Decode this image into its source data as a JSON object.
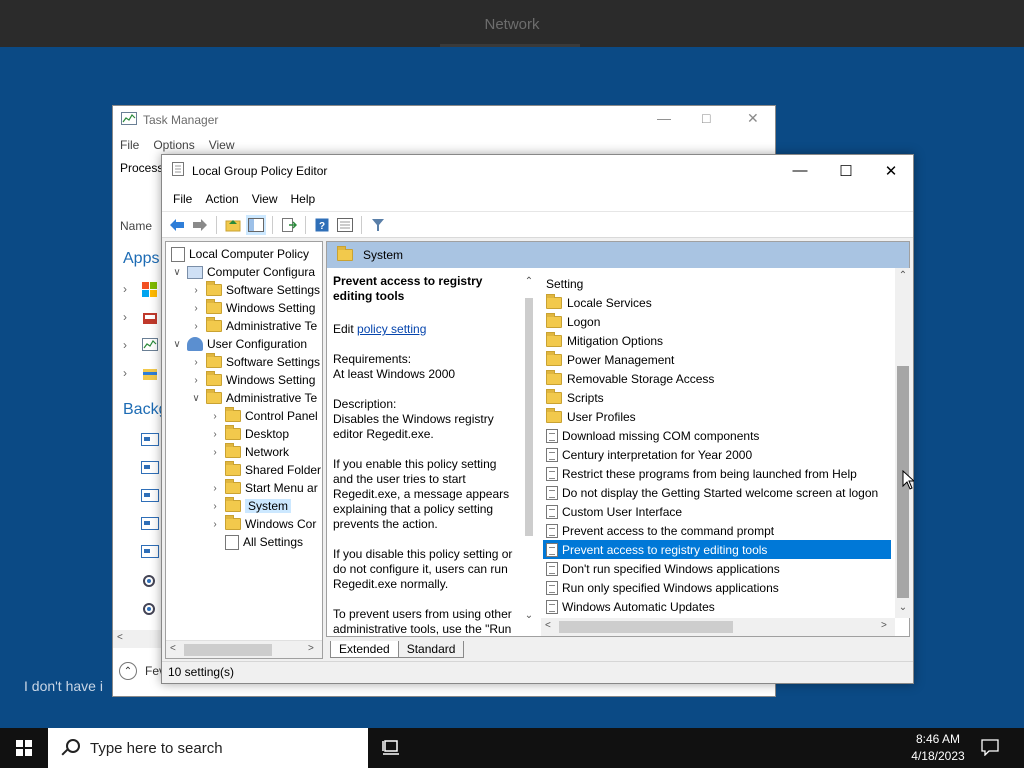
{
  "background": {
    "top_title": "Network",
    "bottom_text": "I don't have i"
  },
  "task_manager": {
    "title": "Task Manager",
    "menu": [
      "File",
      "Options",
      "View"
    ],
    "tab_partial": "Process",
    "col_name": "Name",
    "apps_heading": "Apps",
    "bg_heading": "Backg",
    "fewer_details": "Fev"
  },
  "gpe": {
    "title": "Local Group Policy Editor",
    "menu": [
      "File",
      "Action",
      "View",
      "Help"
    ],
    "tree": [
      {
        "label": "Local Computer Policy",
        "level": 0,
        "icon": "doc-icon",
        "arrow": ""
      },
      {
        "label": "Computer Configura",
        "level": 1,
        "icon": "computer-icon",
        "arrow": "v"
      },
      {
        "label": "Software Settings",
        "level": 2,
        "icon": "folder-icon",
        "arrow": ">"
      },
      {
        "label": "Windows Setting",
        "level": 2,
        "icon": "folder-icon",
        "arrow": ">"
      },
      {
        "label": "Administrative Te",
        "level": 2,
        "icon": "folder-icon",
        "arrow": ">"
      },
      {
        "label": "User Configuration",
        "level": 1,
        "icon": "user-icon",
        "arrow": "v"
      },
      {
        "label": "Software Settings",
        "level": 2,
        "icon": "folder-icon",
        "arrow": ">"
      },
      {
        "label": "Windows Setting",
        "level": 2,
        "icon": "folder-icon",
        "arrow": ">"
      },
      {
        "label": "Administrative Te",
        "level": 2,
        "icon": "folder-icon",
        "arrow": "v"
      },
      {
        "label": "Control Panel",
        "level": 3,
        "icon": "folder-icon",
        "arrow": ">"
      },
      {
        "label": "Desktop",
        "level": 3,
        "icon": "folder-icon",
        "arrow": ">"
      },
      {
        "label": "Network",
        "level": 3,
        "icon": "folder-icon",
        "arrow": ">"
      },
      {
        "label": "Shared Folder",
        "level": 3,
        "icon": "folder-icon",
        "arrow": ""
      },
      {
        "label": "Start Menu ar",
        "level": 3,
        "icon": "folder-icon",
        "arrow": ">"
      },
      {
        "label": "System",
        "level": 3,
        "icon": "folder-icon",
        "arrow": ">",
        "selected": true
      },
      {
        "label": "Windows Cor",
        "level": 3,
        "icon": "folder-icon",
        "arrow": ">"
      },
      {
        "label": "All Settings",
        "level": 3,
        "icon": "all-settings-icon",
        "arrow": ""
      }
    ],
    "pane_header": "System",
    "description": {
      "title": "Prevent access to registry editing tools",
      "edit_prefix": "Edit ",
      "edit_link": "policy setting ",
      "req_label": "Requirements:",
      "req_value": "At least Windows 2000",
      "desc_label": "Description:",
      "desc_text": "Disables the Windows registry editor Regedit.exe.",
      "para1": "If you enable this policy setting and the user tries to start Regedit.exe, a message appears explaining that a policy setting prevents the action.",
      "para2": "If you disable this policy setting or do not configure it, users can run Regedit.exe normally.",
      "para3": "To prevent users from using other administrative tools, use the \"Run"
    },
    "list_header": "Setting",
    "list": [
      {
        "label": "Locale Services",
        "type": "folder"
      },
      {
        "label": "Logon",
        "type": "folder"
      },
      {
        "label": "Mitigation Options",
        "type": "folder"
      },
      {
        "label": "Power Management",
        "type": "folder"
      },
      {
        "label": "Removable Storage Access",
        "type": "folder"
      },
      {
        "label": "Scripts",
        "type": "folder"
      },
      {
        "label": "User Profiles",
        "type": "folder"
      },
      {
        "label": "Download missing COM components",
        "type": "policy"
      },
      {
        "label": "Century interpretation for Year 2000",
        "type": "policy"
      },
      {
        "label": "Restrict these programs from being launched from Help",
        "type": "policy"
      },
      {
        "label": "Do not display the Getting Started welcome screen at logon",
        "type": "policy"
      },
      {
        "label": "Custom User Interface",
        "type": "policy"
      },
      {
        "label": "Prevent access to the command prompt",
        "type": "policy"
      },
      {
        "label": "Prevent access to registry editing tools",
        "type": "policy",
        "selected": true
      },
      {
        "label": "Don't run specified Windows applications",
        "type": "policy"
      },
      {
        "label": "Run only specified Windows applications",
        "type": "policy"
      },
      {
        "label": "Windows Automatic Updates",
        "type": "policy"
      }
    ],
    "tabs": [
      "Extended",
      "Standard"
    ],
    "status": "10 setting(s)"
  },
  "taskbar": {
    "search_placeholder": "Type here to search",
    "time": "8:46 AM",
    "date": "4/18/2023"
  },
  "colors": {
    "desktop_bg": "#0b4a85",
    "selection": "#0078d7",
    "pane_header": "#a9c4e2"
  }
}
